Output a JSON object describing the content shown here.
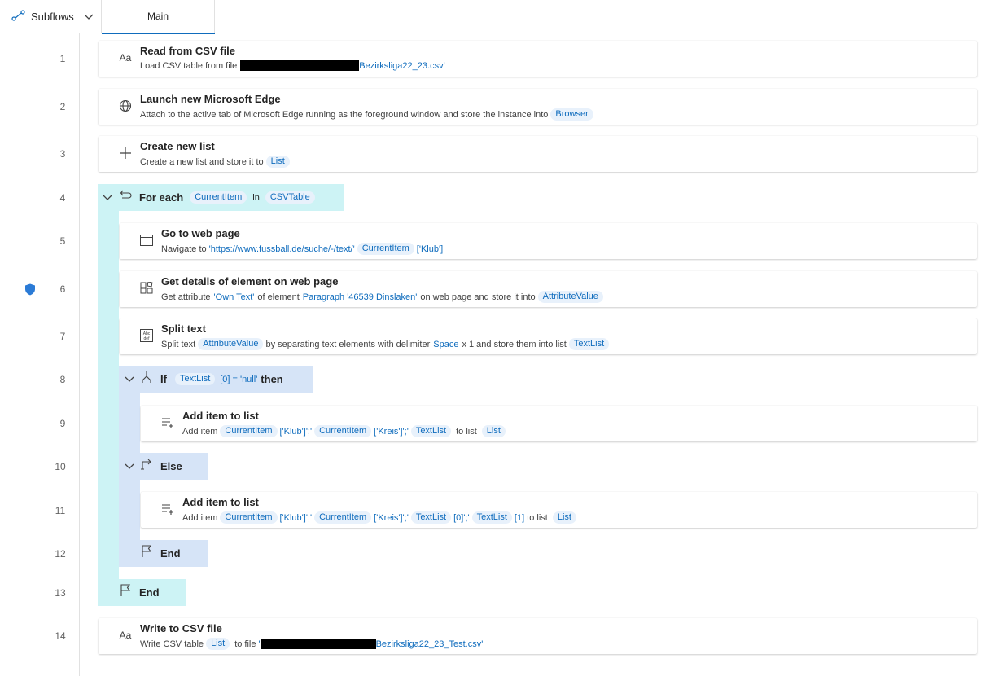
{
  "header": {
    "subflows_label": "Subflows",
    "tab_main": "Main"
  },
  "line_numbers": [
    "1",
    "2",
    "3",
    "4",
    "5",
    "6",
    "7",
    "8",
    "9",
    "10",
    "11",
    "12",
    "13",
    "14"
  ],
  "steps": {
    "s1": {
      "title": "Read from CSV file",
      "desc_prefix": "Load CSV table from file",
      "file": "Bezirksliga22_23.csv'"
    },
    "s2": {
      "title": "Launch new Microsoft Edge",
      "desc_prefix": "Attach to the active tab of Microsoft Edge running as the foreground window and store the instance into",
      "var": "Browser"
    },
    "s3": {
      "title": "Create new list",
      "desc_prefix": "Create a new list and store it to",
      "var": "List"
    },
    "s4": {
      "title": "For each",
      "var": "CurrentItem",
      "in": "in",
      "table": "CSVTable"
    },
    "s5": {
      "title": "Go to web page",
      "desc_prefix": "Navigate to",
      "url": "'https://www.fussball.de/suche/-/text/'",
      "var": "CurrentItem",
      "suffix": "['Klub']"
    },
    "s6": {
      "title": "Get details of element on web page",
      "p1": "Get attribute",
      "attr": "'Own Text'",
      "p2": "of element",
      "elem": "Paragraph '46539 Dinslaken'",
      "p3": "on web page and store it into",
      "var": "AttributeValue"
    },
    "s7": {
      "title": "Split text",
      "p1": "Split text",
      "var1": "AttributeValue",
      "p2": "by separating text elements with delimiter",
      "delim": "Space",
      "p3": "x 1 and store them into list",
      "var2": "TextList"
    },
    "s8": {
      "title": "If",
      "var": "TextList",
      "idx": "[0] =",
      "val": "'null'",
      "then": "then"
    },
    "s9": {
      "title": "Add item to list",
      "p1": "Add item",
      "v1": "CurrentItem",
      "a1": "['Klub']';'",
      "v2": "CurrentItem",
      "a2": "['Kreis']';'",
      "v3": "TextList",
      "p2": "to list",
      "v4": "List"
    },
    "s10": {
      "title": "Else"
    },
    "s11": {
      "title": "Add item to list",
      "p1": "Add item",
      "v1": "CurrentItem",
      "a1": "['Klub']';'",
      "v2": "CurrentItem",
      "a2": "['Kreis']';'",
      "v3": "TextList",
      "a3": "[0]';'",
      "v4": "TextList",
      "a4": "[1]",
      "p2": "to list",
      "v5": "List"
    },
    "s12": {
      "title": "End"
    },
    "s13": {
      "title": "End"
    },
    "s14": {
      "title": "Write to CSV file",
      "p1": "Write CSV table",
      "var": "List",
      "p2": "to file",
      "q": "'",
      "file": "Bezirksliga22_23_Test.csv'"
    }
  },
  "colors": {
    "accent": "#0f6cbd",
    "loop_block": "#cdf3f5",
    "condition_block": "#d6e4f7",
    "token_bg": "#e8f1fb"
  }
}
